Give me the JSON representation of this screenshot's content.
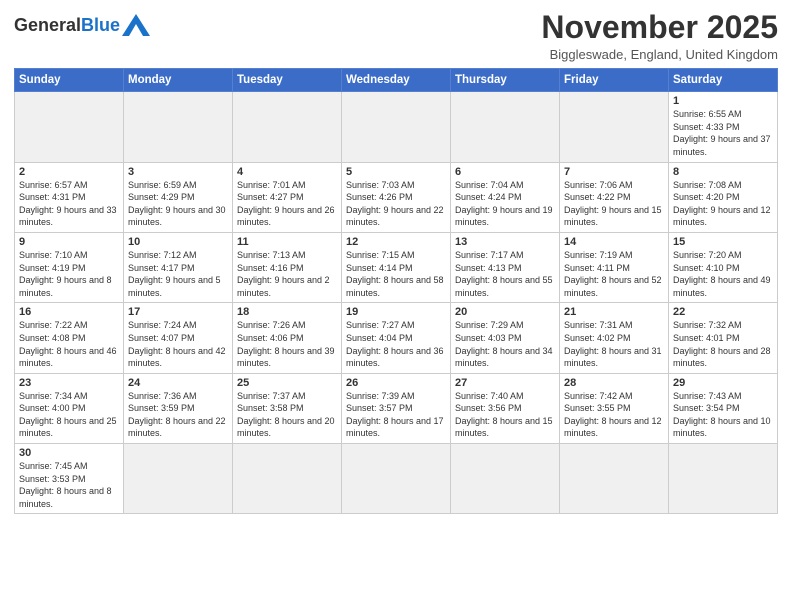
{
  "header": {
    "logo": {
      "general": "General",
      "blue": "Blue"
    },
    "title": "November 2025",
    "subtitle": "Biggleswade, England, United Kingdom"
  },
  "weekdays": [
    "Sunday",
    "Monday",
    "Tuesday",
    "Wednesday",
    "Thursday",
    "Friday",
    "Saturday"
  ],
  "weeks": [
    [
      {
        "day": "",
        "empty": true
      },
      {
        "day": "",
        "empty": true
      },
      {
        "day": "",
        "empty": true
      },
      {
        "day": "",
        "empty": true
      },
      {
        "day": "",
        "empty": true
      },
      {
        "day": "",
        "empty": true
      },
      {
        "day": "1",
        "sunrise": "6:55 AM",
        "sunset": "4:33 PM",
        "daylight": "9 hours and 37 minutes."
      }
    ],
    [
      {
        "day": "2",
        "sunrise": "6:57 AM",
        "sunset": "4:31 PM",
        "daylight": "9 hours and 33 minutes."
      },
      {
        "day": "3",
        "sunrise": "6:59 AM",
        "sunset": "4:29 PM",
        "daylight": "9 hours and 30 minutes."
      },
      {
        "day": "4",
        "sunrise": "7:01 AM",
        "sunset": "4:27 PM",
        "daylight": "9 hours and 26 minutes."
      },
      {
        "day": "5",
        "sunrise": "7:03 AM",
        "sunset": "4:26 PM",
        "daylight": "9 hours and 22 minutes."
      },
      {
        "day": "6",
        "sunrise": "7:04 AM",
        "sunset": "4:24 PM",
        "daylight": "9 hours and 19 minutes."
      },
      {
        "day": "7",
        "sunrise": "7:06 AM",
        "sunset": "4:22 PM",
        "daylight": "9 hours and 15 minutes."
      },
      {
        "day": "8",
        "sunrise": "7:08 AM",
        "sunset": "4:20 PM",
        "daylight": "9 hours and 12 minutes."
      }
    ],
    [
      {
        "day": "9",
        "sunrise": "7:10 AM",
        "sunset": "4:19 PM",
        "daylight": "9 hours and 8 minutes."
      },
      {
        "day": "10",
        "sunrise": "7:12 AM",
        "sunset": "4:17 PM",
        "daylight": "9 hours and 5 minutes."
      },
      {
        "day": "11",
        "sunrise": "7:13 AM",
        "sunset": "4:16 PM",
        "daylight": "9 hours and 2 minutes."
      },
      {
        "day": "12",
        "sunrise": "7:15 AM",
        "sunset": "4:14 PM",
        "daylight": "8 hours and 58 minutes."
      },
      {
        "day": "13",
        "sunrise": "7:17 AM",
        "sunset": "4:13 PM",
        "daylight": "8 hours and 55 minutes."
      },
      {
        "day": "14",
        "sunrise": "7:19 AM",
        "sunset": "4:11 PM",
        "daylight": "8 hours and 52 minutes."
      },
      {
        "day": "15",
        "sunrise": "7:20 AM",
        "sunset": "4:10 PM",
        "daylight": "8 hours and 49 minutes."
      }
    ],
    [
      {
        "day": "16",
        "sunrise": "7:22 AM",
        "sunset": "4:08 PM",
        "daylight": "8 hours and 46 minutes."
      },
      {
        "day": "17",
        "sunrise": "7:24 AM",
        "sunset": "4:07 PM",
        "daylight": "8 hours and 42 minutes."
      },
      {
        "day": "18",
        "sunrise": "7:26 AM",
        "sunset": "4:06 PM",
        "daylight": "8 hours and 39 minutes."
      },
      {
        "day": "19",
        "sunrise": "7:27 AM",
        "sunset": "4:04 PM",
        "daylight": "8 hours and 36 minutes."
      },
      {
        "day": "20",
        "sunrise": "7:29 AM",
        "sunset": "4:03 PM",
        "daylight": "8 hours and 34 minutes."
      },
      {
        "day": "21",
        "sunrise": "7:31 AM",
        "sunset": "4:02 PM",
        "daylight": "8 hours and 31 minutes."
      },
      {
        "day": "22",
        "sunrise": "7:32 AM",
        "sunset": "4:01 PM",
        "daylight": "8 hours and 28 minutes."
      }
    ],
    [
      {
        "day": "23",
        "sunrise": "7:34 AM",
        "sunset": "4:00 PM",
        "daylight": "8 hours and 25 minutes."
      },
      {
        "day": "24",
        "sunrise": "7:36 AM",
        "sunset": "3:59 PM",
        "daylight": "8 hours and 22 minutes."
      },
      {
        "day": "25",
        "sunrise": "7:37 AM",
        "sunset": "3:58 PM",
        "daylight": "8 hours and 20 minutes."
      },
      {
        "day": "26",
        "sunrise": "7:39 AM",
        "sunset": "3:57 PM",
        "daylight": "8 hours and 17 minutes."
      },
      {
        "day": "27",
        "sunrise": "7:40 AM",
        "sunset": "3:56 PM",
        "daylight": "8 hours and 15 minutes."
      },
      {
        "day": "28",
        "sunrise": "7:42 AM",
        "sunset": "3:55 PM",
        "daylight": "8 hours and 12 minutes."
      },
      {
        "day": "29",
        "sunrise": "7:43 AM",
        "sunset": "3:54 PM",
        "daylight": "8 hours and 10 minutes."
      }
    ],
    [
      {
        "day": "30",
        "sunrise": "7:45 AM",
        "sunset": "3:53 PM",
        "daylight": "8 hours and 8 minutes."
      },
      {
        "day": "",
        "empty": true
      },
      {
        "day": "",
        "empty": true
      },
      {
        "day": "",
        "empty": true
      },
      {
        "day": "",
        "empty": true
      },
      {
        "day": "",
        "empty": true
      },
      {
        "day": "",
        "empty": true
      }
    ]
  ],
  "labels": {
    "sunrise": "Sunrise:",
    "sunset": "Sunset:",
    "daylight": "Daylight:"
  }
}
